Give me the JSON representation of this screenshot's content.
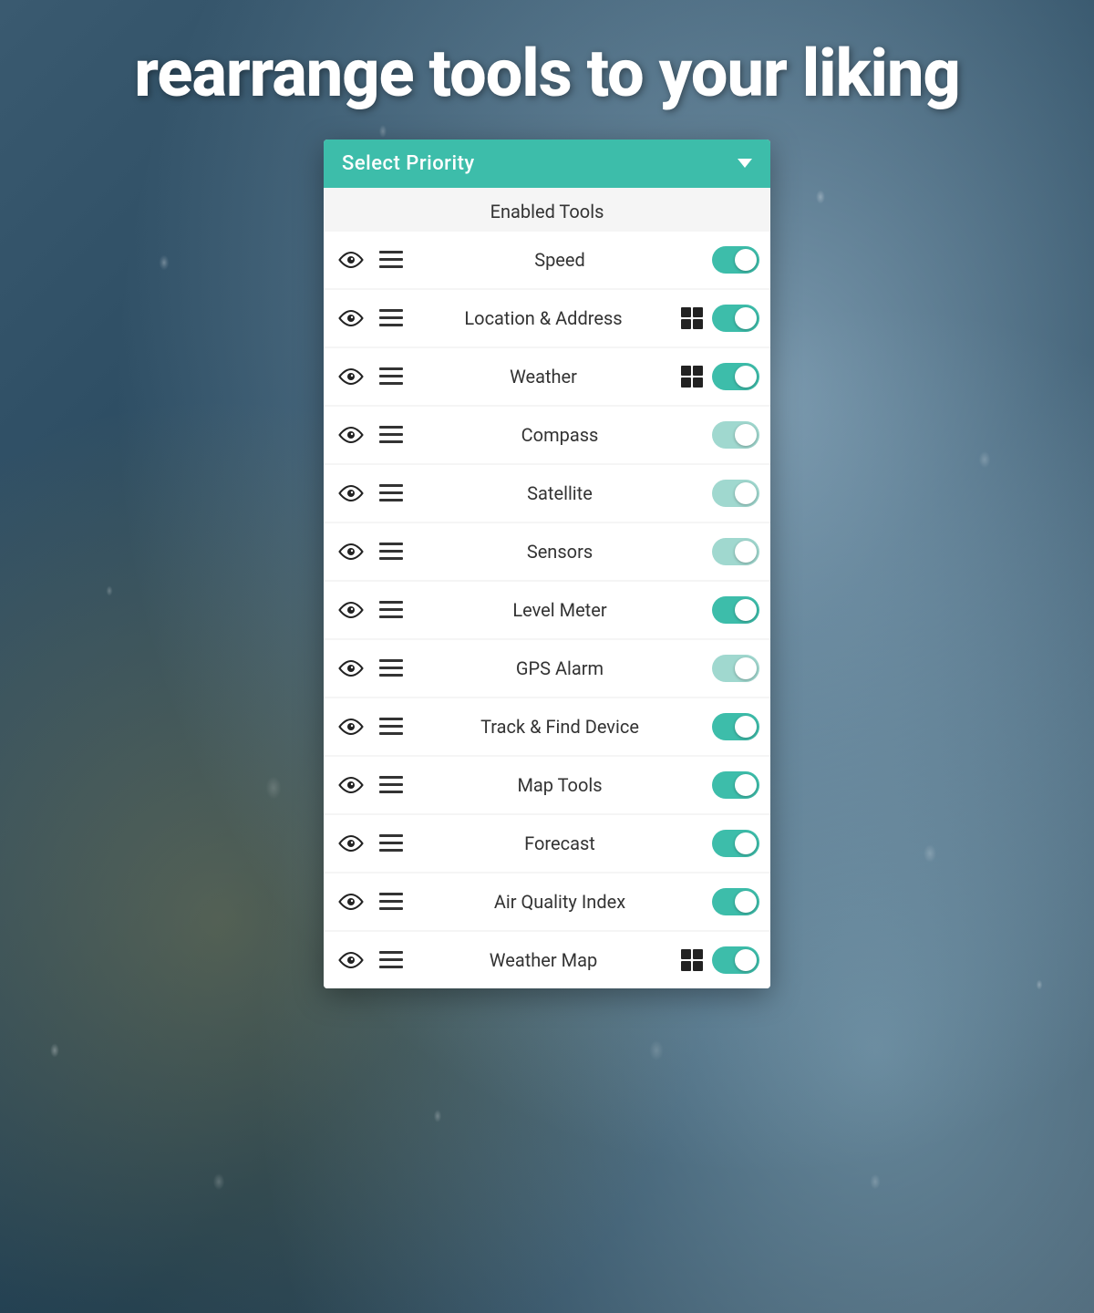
{
  "headline": "rearrange tools to your liking",
  "card": {
    "header": {
      "title": "Select Priority",
      "chevron": "chevron-down"
    },
    "section_label": "Enabled Tools",
    "tools": [
      {
        "id": "speed",
        "name": "Speed",
        "has_widget": false,
        "enabled": true,
        "toggle_dim": false
      },
      {
        "id": "location-address",
        "name": "Location & Address",
        "has_widget": true,
        "enabled": true,
        "toggle_dim": false
      },
      {
        "id": "weather",
        "name": "Weather",
        "has_widget": true,
        "enabled": true,
        "toggle_dim": false
      },
      {
        "id": "compass",
        "name": "Compass",
        "has_widget": false,
        "enabled": true,
        "toggle_dim": true
      },
      {
        "id": "satellite",
        "name": "Satellite",
        "has_widget": false,
        "enabled": true,
        "toggle_dim": true
      },
      {
        "id": "sensors",
        "name": "Sensors",
        "has_widget": false,
        "enabled": true,
        "toggle_dim": true
      },
      {
        "id": "level-meter",
        "name": "Level Meter",
        "has_widget": false,
        "enabled": true,
        "toggle_dim": false
      },
      {
        "id": "gps-alarm",
        "name": "GPS Alarm",
        "has_widget": false,
        "enabled": true,
        "toggle_dim": true
      },
      {
        "id": "track-find-device",
        "name": "Track & Find Device",
        "has_widget": false,
        "enabled": true,
        "toggle_dim": false
      },
      {
        "id": "map-tools",
        "name": "Map Tools",
        "has_widget": false,
        "enabled": true,
        "toggle_dim": false
      },
      {
        "id": "forecast",
        "name": "Forecast",
        "has_widget": false,
        "enabled": true,
        "toggle_dim": false
      },
      {
        "id": "air-quality-index",
        "name": "Air Quality Index",
        "has_widget": false,
        "enabled": true,
        "toggle_dim": false
      },
      {
        "id": "weather-map",
        "name": "Weather Map",
        "has_widget": true,
        "enabled": true,
        "toggle_dim": false
      }
    ]
  },
  "colors": {
    "teal": "#3dbdaa",
    "teal_dim": "#a0d8cf"
  }
}
